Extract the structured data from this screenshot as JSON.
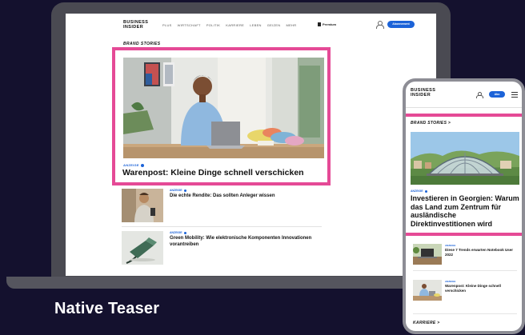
{
  "desktop": {
    "logo_line1": "BUSINESS",
    "logo_line2": "INSIDER",
    "nav": [
      "PLUS",
      "WIRTSCHAFT",
      "POLITIK",
      "KARRIERE",
      "LEBEN",
      "GEIZEN",
      "MEHR"
    ],
    "premium_label": "Premium",
    "abo_label": "Abonnement",
    "section_label": "BRAND STORIES",
    "featured": {
      "anzeige": "ANZEIGE",
      "title": "Warenpost: Kleine Dinge schnell verschicken"
    },
    "teasers": [
      {
        "anzeige": "ANZEIGE",
        "title": "Die echte Rendite: Das sollten Anleger wissen"
      },
      {
        "anzeige": "ANZEIGE",
        "title": "Green Mobility: Wie elektronische Komponenten Innovationen vorantreiben"
      }
    ]
  },
  "mobile": {
    "logo_line1": "BUSINESS",
    "logo_line2": "INSIDER",
    "abo_label": "Abo",
    "section_label": "BRAND STORIES >",
    "featured": {
      "anzeige": "ANZEIGE",
      "title": "Investieren in Georgien: Warum das Land zum Zentrum für ausländische Direktinvestitionen wird"
    },
    "teasers": [
      {
        "anzeige": "ANZEIGE",
        "title": "Diese 7 Trends erwarten Notebook User 2022"
      },
      {
        "anzeige": "ANZEIGE",
        "title": "Warenpost: Kleine Dinge schnell verschicken"
      }
    ],
    "footer_section": "KARRIERE >"
  },
  "caption": "Native Teaser",
  "colors": {
    "background": "#14112e",
    "highlight": "#e54a96",
    "accent": "#1c63d8"
  }
}
